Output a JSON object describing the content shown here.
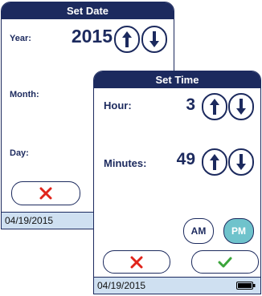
{
  "set_date": {
    "title": "Set Date",
    "year_label": "Year:",
    "year_value": "2015",
    "month_label": "Month:",
    "day_label": "Day:",
    "status_date": "04/19/2015"
  },
  "set_time": {
    "title": "Set Time",
    "hour_label": "Hour:",
    "hour_value": "3",
    "minutes_label": "Minutes:",
    "minutes_value": "49",
    "am_label": "AM",
    "pm_label": "PM",
    "selected_period": "PM",
    "status_date": "04/19/2015",
    "battery_level": 1.0
  },
  "colors": {
    "navy": "#1c2a5e",
    "status_bar": "#cfe0f1",
    "pm_active": "#6fc3cc",
    "cancel_red": "#e0241b",
    "confirm_green": "#3ba53b"
  },
  "icons": {
    "up": "arrow-up-icon",
    "down": "arrow-down-icon",
    "cancel": "x-icon",
    "confirm": "check-icon",
    "battery": "battery-icon"
  }
}
